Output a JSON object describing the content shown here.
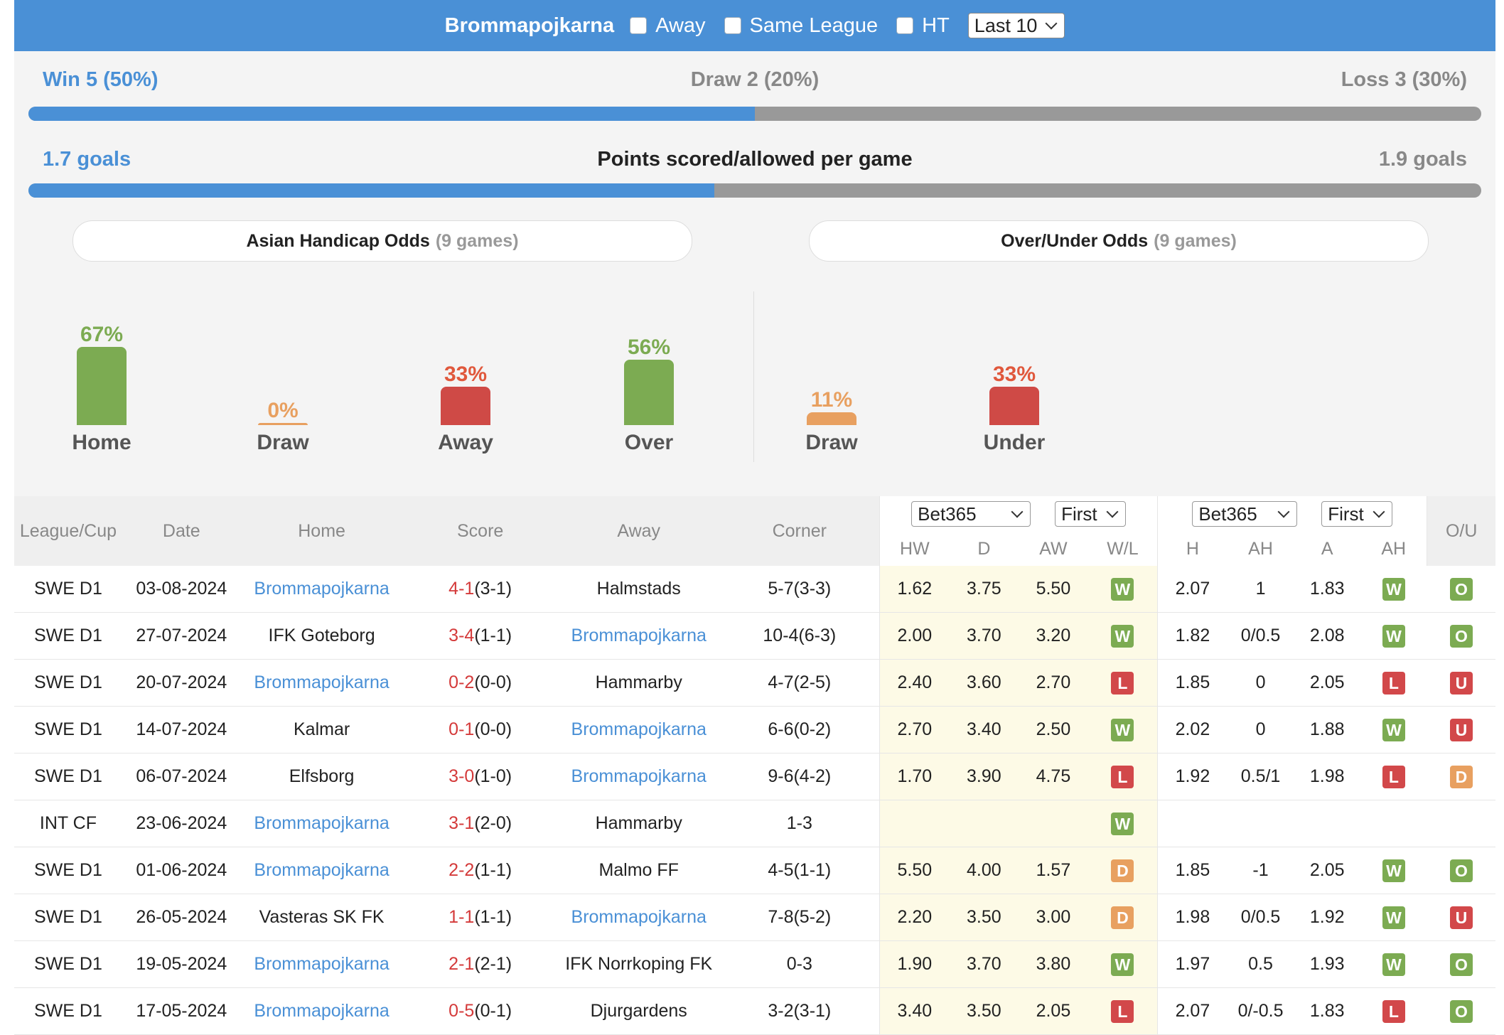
{
  "header": {
    "team": "Brommapojkarna",
    "away_label": "Away",
    "same_league_label": "Same League",
    "ht_label": "HT",
    "last_select": "Last 10"
  },
  "summary": {
    "win": "Win 5 (50%)",
    "draw": "Draw 2 (20%)",
    "loss": "Loss 3 (30%)",
    "win_fraction": 0.5,
    "goals_left": "1.7 goals",
    "goals_title": "Points scored/allowed per game",
    "goals_right": "1.9 goals",
    "goals_fraction": 0.472
  },
  "asian": {
    "title": "Asian Handicap Odds",
    "games": "(9 games)",
    "cols": [
      {
        "pct": "67%",
        "label": "Home",
        "value": 67
      },
      {
        "pct": "0%",
        "label": "Draw",
        "value": 0
      },
      {
        "pct": "33%",
        "label": "Away",
        "value": 33
      }
    ]
  },
  "ou": {
    "title": "Over/Under Odds",
    "games": "(9 games)",
    "cols": [
      {
        "pct": "56%",
        "label": "Over",
        "value": 56
      },
      {
        "pct": "11%",
        "label": "Draw",
        "value": 11
      },
      {
        "pct": "33%",
        "label": "Under",
        "value": 33
      }
    ]
  },
  "table": {
    "headers": {
      "league": "League/Cup",
      "date": "Date",
      "home": "Home",
      "score": "Score",
      "away": "Away",
      "corner": "Corner",
      "ou": "O/U"
    },
    "bookmaker1": "Bet365",
    "period1": "First",
    "bookmaker2": "Bet365",
    "period2": "First",
    "sub1": [
      "HW",
      "D",
      "AW",
      "W/L"
    ],
    "sub2": [
      "H",
      "AH",
      "A",
      "AH"
    ],
    "rows": [
      {
        "league": "SWE D1",
        "date": "03-08-2024",
        "home": "Brommapojkarna",
        "ft": "4-1",
        "ht": "(3-1)",
        "away": "Halmstads",
        "corner": "5-7(3-3)",
        "hw": "1.62",
        "d": "3.75",
        "aw": "5.50",
        "wl": "W",
        "h": "2.07",
        "ah": "1",
        "a": "1.83",
        "ahr": "W",
        "ou": "O",
        "bromma_home": true
      },
      {
        "league": "SWE D1",
        "date": "27-07-2024",
        "home": "IFK Goteborg",
        "ft": "3-4",
        "ht": "(1-1)",
        "away": "Brommapojkarna",
        "corner": "10-4(6-3)",
        "hw": "2.00",
        "d": "3.70",
        "aw": "3.20",
        "wl": "W",
        "h": "1.82",
        "ah": "0/0.5",
        "a": "2.08",
        "ahr": "W",
        "ou": "O",
        "bromma_home": false
      },
      {
        "league": "SWE D1",
        "date": "20-07-2024",
        "home": "Brommapojkarna",
        "ft": "0-2",
        "ht": "(0-0)",
        "away": "Hammarby",
        "corner": "4-7(2-5)",
        "hw": "2.40",
        "d": "3.60",
        "aw": "2.70",
        "wl": "L",
        "h": "1.85",
        "ah": "0",
        "a": "2.05",
        "ahr": "L",
        "ou": "U",
        "bromma_home": true
      },
      {
        "league": "SWE D1",
        "date": "14-07-2024",
        "home": "Kalmar",
        "ft": "0-1",
        "ht": "(0-0)",
        "away": "Brommapojkarna",
        "corner": "6-6(0-2)",
        "hw": "2.70",
        "d": "3.40",
        "aw": "2.50",
        "wl": "W",
        "h": "2.02",
        "ah": "0",
        "a": "1.88",
        "ahr": "W",
        "ou": "U",
        "bromma_home": false
      },
      {
        "league": "SWE D1",
        "date": "06-07-2024",
        "home": "Elfsborg",
        "ft": "3-0",
        "ht": "(1-0)",
        "away": "Brommapojkarna",
        "corner": "9-6(4-2)",
        "hw": "1.70",
        "d": "3.90",
        "aw": "4.75",
        "wl": "L",
        "h": "1.92",
        "ah": "0.5/1",
        "a": "1.98",
        "ahr": "L",
        "ou": "D",
        "bromma_home": false
      },
      {
        "league": "INT CF",
        "date": "23-06-2024",
        "home": "Brommapojkarna",
        "ft": "3-1",
        "ht": "(2-0)",
        "away": "Hammarby",
        "corner": "1-3",
        "hw": "",
        "d": "",
        "aw": "",
        "wl": "W",
        "h": "",
        "ah": "",
        "a": "",
        "ahr": "",
        "ou": "",
        "bromma_home": true
      },
      {
        "league": "SWE D1",
        "date": "01-06-2024",
        "home": "Brommapojkarna",
        "ft": "2-2",
        "ht": "(1-1)",
        "away": "Malmo FF",
        "corner": "4-5(1-1)",
        "hw": "5.50",
        "d": "4.00",
        "aw": "1.57",
        "wl": "D",
        "h": "1.85",
        "ah": "-1",
        "a": "2.05",
        "ahr": "W",
        "ou": "O",
        "bromma_home": true
      },
      {
        "league": "SWE D1",
        "date": "26-05-2024",
        "home": "Vasteras SK FK",
        "ft": "1-1",
        "ht": "(1-1)",
        "away": "Brommapojkarna",
        "corner": "7-8(5-2)",
        "hw": "2.20",
        "d": "3.50",
        "aw": "3.00",
        "wl": "D",
        "h": "1.98",
        "ah": "0/0.5",
        "a": "1.92",
        "ahr": "W",
        "ou": "U",
        "bromma_home": false
      },
      {
        "league": "SWE D1",
        "date": "19-05-2024",
        "home": "Brommapojkarna",
        "ft": "2-1",
        "ht": "(2-1)",
        "away": "IFK Norrkoping FK",
        "corner": "0-3",
        "hw": "1.90",
        "d": "3.70",
        "aw": "3.80",
        "wl": "W",
        "h": "1.97",
        "ah": "0.5",
        "a": "1.93",
        "ahr": "W",
        "ou": "O",
        "bromma_home": true
      },
      {
        "league": "SWE D1",
        "date": "17-05-2024",
        "home": "Brommapojkarna",
        "ft": "0-5",
        "ht": "(0-1)",
        "away": "Djurgardens",
        "corner": "3-2(3-1)",
        "hw": "3.40",
        "d": "3.50",
        "aw": "2.05",
        "wl": "L",
        "h": "2.07",
        "ah": "0/-0.5",
        "a": "1.83",
        "ahr": "L",
        "ou": "O",
        "bromma_home": true
      }
    ]
  }
}
